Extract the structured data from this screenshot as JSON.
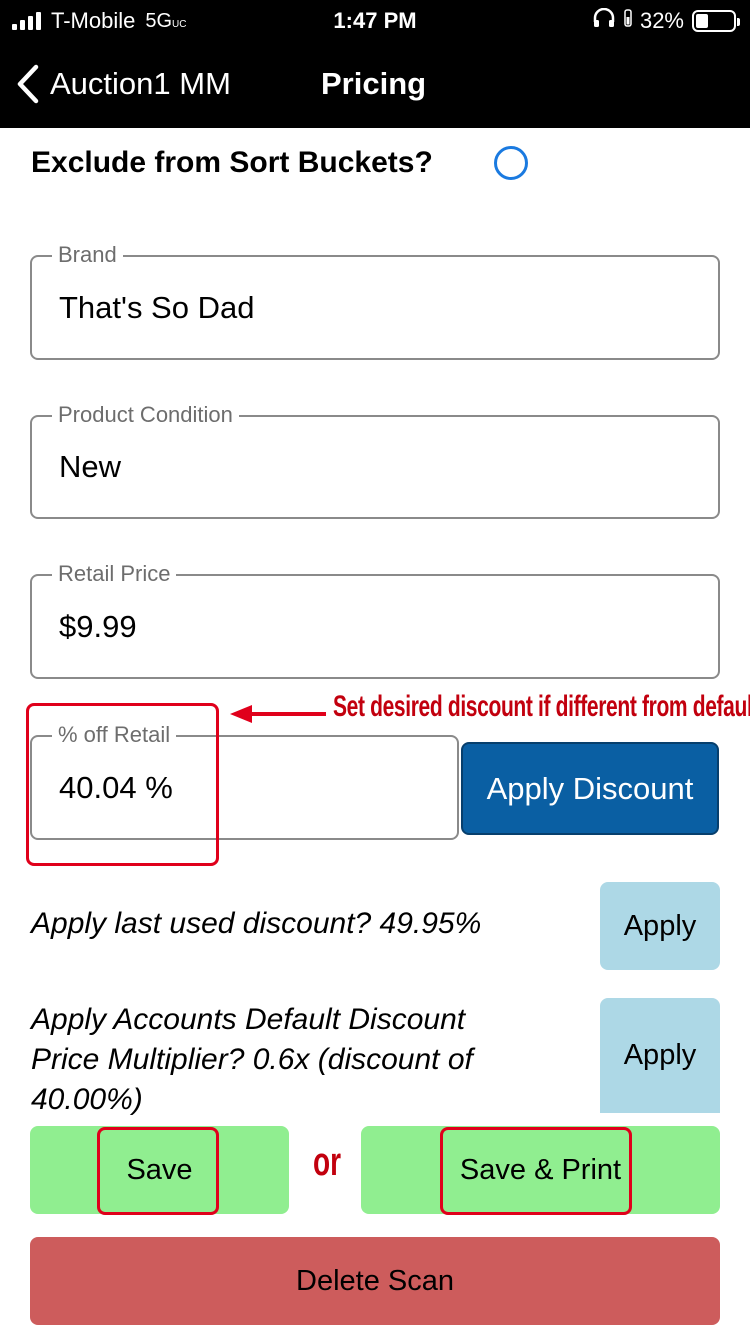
{
  "status_bar": {
    "carrier": "T-Mobile",
    "network": "5G",
    "network_sub": "UC",
    "time": "1:47 PM",
    "battery": "32%",
    "battery_level": 0.32
  },
  "nav": {
    "back_label": "Auction1 MM",
    "title": "Pricing"
  },
  "exclude": {
    "label": "Exclude from Sort Buckets?",
    "checked": false
  },
  "fields": {
    "brand": {
      "label": "Brand",
      "value": "That's So Dad"
    },
    "condition": {
      "label": "Product Condition",
      "value": "New"
    },
    "retail_price": {
      "label": "Retail Price",
      "value": "$9.99"
    },
    "percent_off": {
      "label": "% off Retail",
      "value": "40.04 %"
    }
  },
  "apply_discount_label": "Apply Discount",
  "annotation": {
    "text": "Set desired discount if different from default",
    "or": "or"
  },
  "last_discount": {
    "text": "Apply last used discount? 49.95%",
    "button": "Apply"
  },
  "default_discount": {
    "line1": "Apply Accounts Default Discount",
    "line2": "Price Multiplier? 0.6x (discount of",
    "line3": "40.00%)",
    "button": "Apply"
  },
  "actions": {
    "save": "Save",
    "save_print": "Save & Print",
    "delete": "Delete Scan"
  },
  "colors": {
    "accent_blue": "#0a5fa3",
    "radio_blue": "#1a7ae0",
    "green": "#90ee90",
    "light_blue": "#add8e6",
    "delete_red": "#cd5c5c",
    "annotation_red": "#e0001b"
  }
}
